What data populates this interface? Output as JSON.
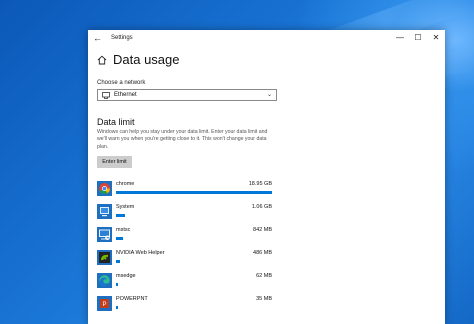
{
  "window": {
    "title": "Settings",
    "controls": {
      "minimize": "—",
      "maximize": "☐",
      "close": "✕"
    }
  },
  "page": {
    "title": "Data usage"
  },
  "network": {
    "label": "Choose a network",
    "selected": "Ethernet"
  },
  "data_limit": {
    "title": "Data limit",
    "description": "Windows can help you stay under your data limit. Enter your data limit and we'll warn you when you're getting close to it. This won't change your data plan.",
    "button": "Enter limit"
  },
  "apps": [
    {
      "name": "chrome",
      "size": "18.95 GB",
      "usage_fraction": 1.0,
      "icon": "chrome-icon"
    },
    {
      "name": "System",
      "size": "1.06 GB",
      "usage_fraction": 0.056,
      "icon": "system-icon"
    },
    {
      "name": "mstsc",
      "size": "842 MB",
      "usage_fraction": 0.045,
      "icon": "remote-desktop-icon"
    },
    {
      "name": "NVIDIA Web Helper",
      "size": "486 MB",
      "usage_fraction": 0.026,
      "icon": "nvidia-icon"
    },
    {
      "name": "msedge",
      "size": "62 MB",
      "usage_fraction": 0.005,
      "icon": "edge-icon"
    },
    {
      "name": "POWERPNT",
      "size": "35 MB",
      "usage_fraction": 0.003,
      "icon": "powerpoint-icon"
    }
  ],
  "colors": {
    "accent": "#0078d7",
    "desktop": "#1a76d6"
  }
}
